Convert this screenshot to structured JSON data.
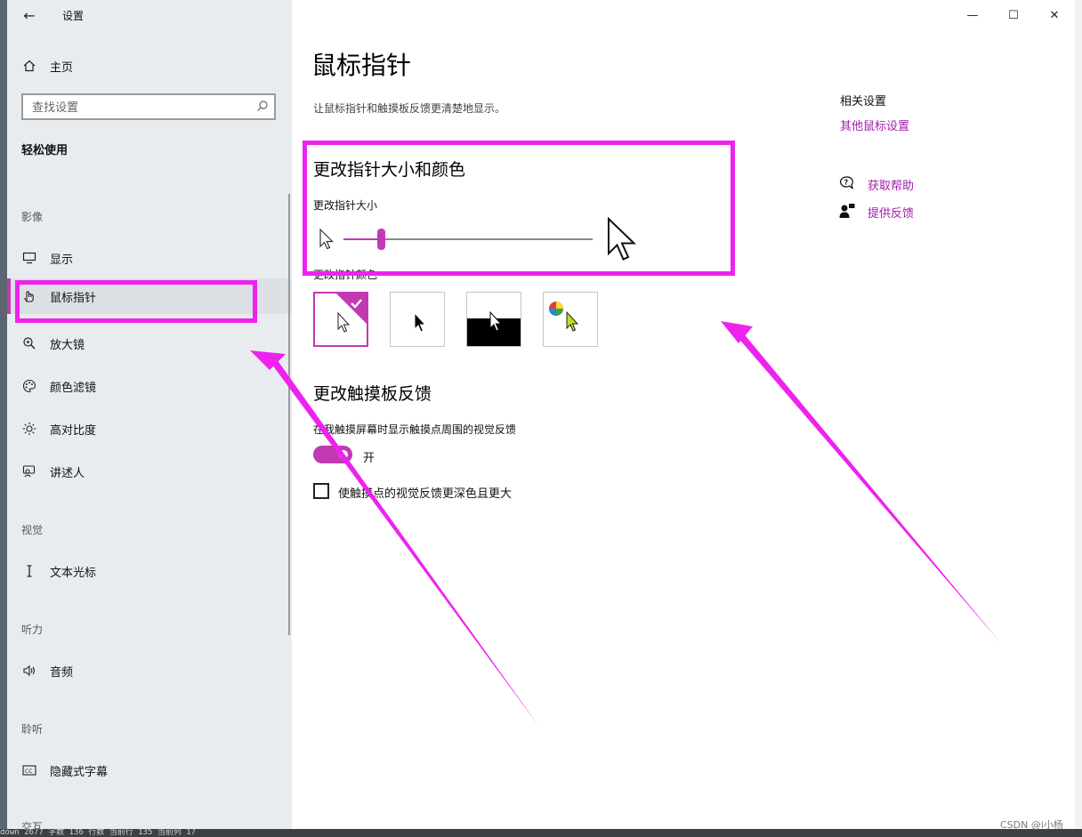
{
  "app": {
    "title": "设置",
    "back_glyph": "←"
  },
  "window_controls": {
    "minimize": "—",
    "maximize": "☐",
    "close": "✕"
  },
  "sidebar": {
    "home": {
      "label": "主页",
      "icon": "home-icon"
    },
    "search": {
      "placeholder": "查找设置",
      "icon": "search-icon"
    },
    "group_title": "轻松使用",
    "sections": [
      {
        "label": "影像"
      },
      {
        "label": "视觉"
      },
      {
        "label": "听力"
      },
      {
        "label": "聆听"
      },
      {
        "label": "交互"
      }
    ],
    "items": [
      {
        "label": "显示",
        "icon": "monitor-icon"
      },
      {
        "label": "鼠标指针",
        "icon": "pointer-icon",
        "selected": true
      },
      {
        "label": "放大镜",
        "icon": "magnifier-icon"
      },
      {
        "label": "颜色滤镜",
        "icon": "palette-icon"
      },
      {
        "label": "高对比度",
        "icon": "brightness-icon"
      },
      {
        "label": "讲述人",
        "icon": "narrator-icon"
      },
      {
        "label": "文本光标",
        "icon": "text-cursor-icon"
      },
      {
        "label": "音频",
        "icon": "speaker-icon"
      },
      {
        "label": "隐藏式字幕",
        "icon": "cc-icon"
      }
    ]
  },
  "main": {
    "title": "鼠标指针",
    "description": "让鼠标指针和触摸板反馈更清楚地显示。",
    "size_color_heading": "更改指针大小和颜色",
    "size_label": "更改指针大小",
    "size_slider_value": 0.15,
    "color_label": "更改指针颜色",
    "color_options": [
      {
        "name": "white",
        "selected": true
      },
      {
        "name": "black",
        "selected": false
      },
      {
        "name": "inverted",
        "selected": false
      },
      {
        "name": "custom",
        "selected": false
      }
    ],
    "touch_heading": "更改触摸板反馈",
    "touch_feedback_label": "在我触摸屏幕时显示触摸点周围的视觉反馈",
    "touch_feedback_state": "开",
    "darker_label": "使触摸点的视觉反馈更深色且更大"
  },
  "related": {
    "title": "相关设置",
    "link": "其他鼠标设置",
    "help": "获取帮助",
    "feedback": "提供反馈"
  },
  "colors": {
    "accent": "#c239b3",
    "annotation": "#ee22ee"
  },
  "watermark": "CSDN @i小杨",
  "background_status": "down  2677 字数  136 行数  当前行 135  当前列 17"
}
